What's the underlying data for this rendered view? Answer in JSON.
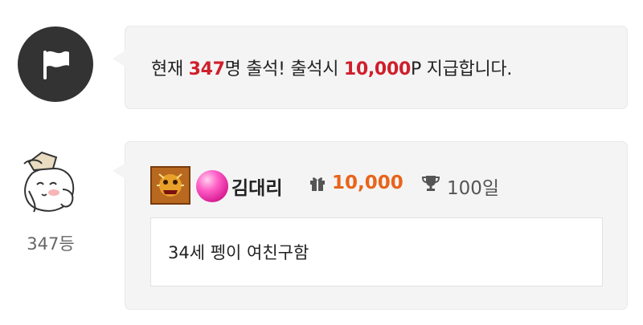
{
  "notice": {
    "icon": "flag-icon",
    "prefix": "현재 ",
    "count": "347",
    "middle": "명 출석! 출석시 ",
    "points": "10,000",
    "suffix": "P 지급합니다."
  },
  "entry": {
    "avatar_icon": "character-avatar",
    "rank": "347등",
    "badge_icon": "level-badge-icon",
    "gem_icon": "pink-gem-icon",
    "nickname": "김대리",
    "gift_icon": "gift-icon",
    "points": "10,000",
    "trophy_icon": "trophy-icon",
    "days": "100일",
    "message": "34세 펭이 여친구함"
  },
  "colors": {
    "highlight_red": "#cf1f2b",
    "points_orange": "#e8641b",
    "bubble_bg": "#f4f4f4"
  }
}
